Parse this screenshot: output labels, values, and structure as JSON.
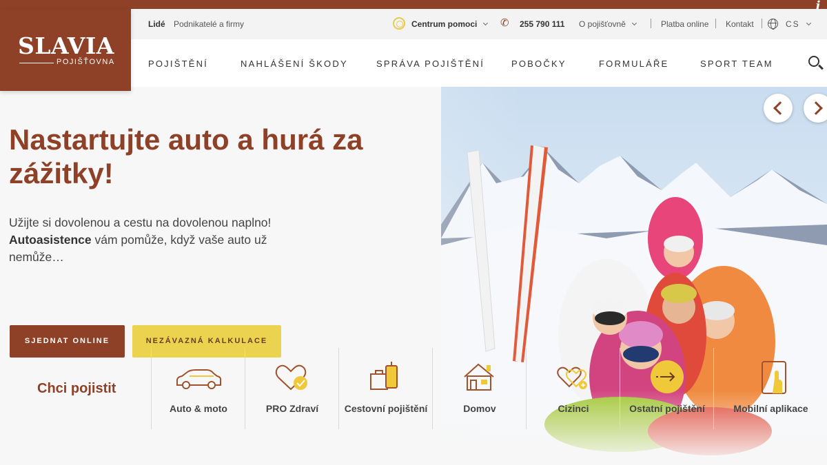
{
  "brand": {
    "name": "SLAVIA",
    "sub": "POJIŠŤOVNA"
  },
  "utility": {
    "lide": "Lidé",
    "firmy": "Podnikatelé a firmy",
    "help": "Centrum pomoci",
    "phone": "255 790 111",
    "about": "O pojišťovně",
    "pay": "Platba online",
    "contact": "Kontakt",
    "lang": "CS"
  },
  "nav": [
    "POJIŠTĚNÍ",
    "NAHLÁŠENÍ ŠKODY",
    "SPRÁVA POJIŠTĚNÍ",
    "POBOČKY",
    "FORMULÁŘE",
    "SPORT TEAM"
  ],
  "hero": {
    "title": "Nastartujte auto a hurá za zážitky!",
    "lead1": "Užijte si dovolenou a cestu na dovolenou naplno!",
    "lead_bold": "Autoasistence",
    "lead2": " vám pomůže, když vaše auto už nemůže…",
    "cta_primary": "SJEDNAT ONLINE",
    "cta_secondary": "NEZÁVAZNÁ KALKULACE"
  },
  "picker": {
    "title": "Chci pojistit",
    "items": [
      "Auto & moto",
      "PRO Zdraví",
      "Cestovní pojištění",
      "Domov",
      "Cizinci",
      "Ostatní pojištění",
      "Mobilní aplikace"
    ]
  },
  "colors": {
    "brand": "#8e4127",
    "accent": "#ecd34f",
    "icon_brown": "#a0522d",
    "icon_yellow": "#f0c93a"
  }
}
